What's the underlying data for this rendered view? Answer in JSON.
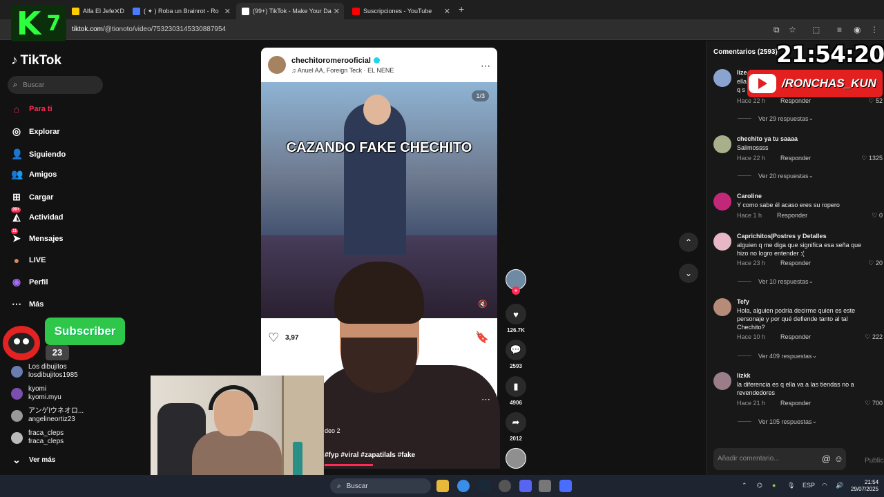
{
  "browser": {
    "tabs": [
      {
        "title": "Alfa El Jefe - De",
        "close": "✕",
        "favicon_color": "#ffcc00"
      },
      {
        "title": "( ✦ ) Roba un Brainrot - Ro",
        "close": "✕",
        "favicon_color": "#4a7cff"
      },
      {
        "title": "(99+) TikTok - Make Your Da",
        "close": "✕",
        "favicon_color": "#ffffff"
      },
      {
        "title": "Suscripciones - YouTube",
        "close": "✕",
        "favicon_color": "#ff0000"
      }
    ],
    "new_tab": "+",
    "url_domain": "tiktok.com",
    "url_path": "/@tionoto/video/7532303145330887954"
  },
  "overlay": {
    "logo_k": "K",
    "logo_n": "7",
    "clock": "21:54:20",
    "yt_handle": "/RONCHAS_KUN",
    "subscriber_label": "Subscriber",
    "subscriber_count": "23"
  },
  "sidebar": {
    "logo": "TikTok",
    "search_placeholder": "Buscar",
    "items": [
      {
        "label": "Para ti",
        "icon": "⌂"
      },
      {
        "label": "Explorar",
        "icon": "◎"
      },
      {
        "label": "Siguiendo",
        "icon": "👤"
      },
      {
        "label": "Amigos",
        "icon": "👥"
      },
      {
        "label": "Cargar",
        "icon": "⊞"
      },
      {
        "label": "Actividad",
        "icon": "◭",
        "badge": "99+"
      },
      {
        "label": "Mensajes",
        "icon": "➤",
        "badge": "11"
      },
      {
        "label": "LIVE",
        "icon": "●"
      },
      {
        "label": "Perfil",
        "icon": "◉"
      },
      {
        "label": "Más",
        "icon": "⋯"
      }
    ],
    "accounts": [
      {
        "name": "Los dibujitos",
        "handle": "losdibujitos1985"
      },
      {
        "name": "kyomi",
        "handle": "kyomi.myu"
      },
      {
        "name": "アンゲlウネオロ...",
        "handle": "angelineortiz23"
      },
      {
        "name": "fraca_cleps",
        "handle": "fraca_cleps"
      }
    ],
    "see_more": "Ver más"
  },
  "post": {
    "username": "chechitoromerooficial",
    "song": "♫ Anuel AA, Foreign Teck · EL NENE",
    "more": "⋯",
    "counter": "1/3",
    "caption": "CAZANDO FAKE CHECHITO",
    "likes": "3,97",
    "hashtags": "#fyp #viral #zapatilals #fake",
    "video_label": "deo  2"
  },
  "rail": {
    "likes": "126.7K",
    "comments": "2593",
    "saves": "4906",
    "shares": "2012"
  },
  "comments": {
    "header": "Comentarios (2593)",
    "input_placeholder": "Añadir comentario...",
    "publish": "Publicar",
    "reply_label": "Responder",
    "items": [
      {
        "user": "lize",
        "text": "ella\nq s",
        "time": "Hace 22 h",
        "likes": "52",
        "replies": "Ver 29 respuestas"
      },
      {
        "user": "chechito ya tu saaaa",
        "text": "Salimossss",
        "time": "Hace 22 h",
        "likes": "1325",
        "replies": "Ver 20 respuestas"
      },
      {
        "user": "Caroline",
        "text": "Y como sabe él acaso eres su ropero",
        "time": "Hace 1 h",
        "likes": "0",
        "replies": ""
      },
      {
        "user": "Caprichitos|Postres y Detalles",
        "text": "alguien q me diga que significa esa seña que hizo  no logro entender :(",
        "time": "Hace 23 h",
        "likes": "20",
        "replies": "Ver 10 respuestas"
      },
      {
        "user": "Tefy",
        "text": "Hola, alguien podría decirme quien es este personaje y por qué defiende tanto al tal Chechito?",
        "time": "Hace 10 h",
        "likes": "222",
        "replies": "Ver 409 respuestas"
      },
      {
        "user": "lizkk",
        "text": "la diferencia es q ella va a las tiendas no a revendedores",
        "time": "Hace 21 h",
        "likes": "700",
        "replies": "Ver 105 respuestas"
      }
    ]
  },
  "taskbar": {
    "search": "Buscar",
    "lang": "ESP",
    "time": "21:54",
    "date": "29/07/2025"
  }
}
